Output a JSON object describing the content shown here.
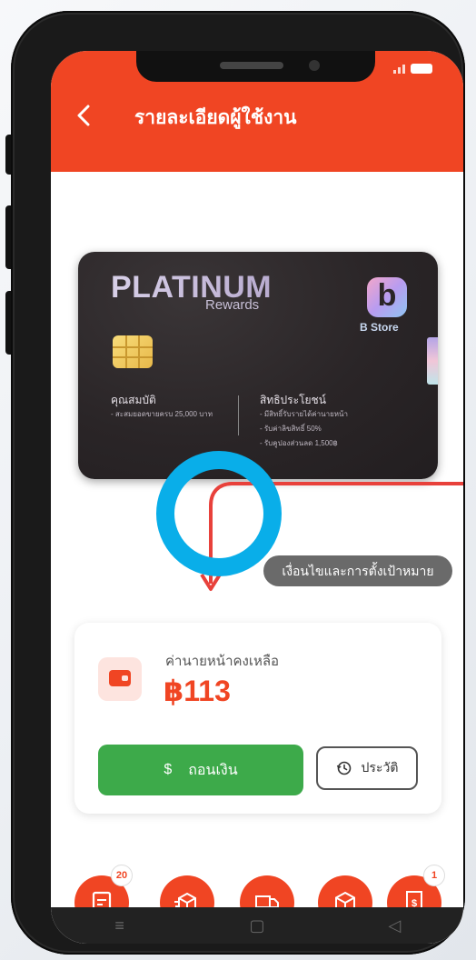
{
  "header": {
    "title": "รายละเอียดผู้ใช้งาน",
    "back_icon": "chevron-left-icon"
  },
  "status_bar": {
    "icons": [
      "signal-icon",
      "battery-icon"
    ]
  },
  "membership_card": {
    "tier": "PLATINUM",
    "tier_subtitle": "Rewards",
    "brand": "B Store",
    "qualification": {
      "heading": "คุณสมบัติ",
      "lines": [
        "- สะสมยอดขายครบ 25,000 บาท"
      ]
    },
    "benefits": {
      "heading": "สิทธิประโยชน์",
      "lines": [
        "- มีสิทธิ์รับรายได้ค่านายหน้า",
        "- รับค่าลิขสิทธิ์ 50%",
        "- รับคูปองส่วนลด 1,500฿"
      ]
    }
  },
  "goal_button": {
    "label": "เงื่อนไขและการตั้งเป้าหมาย"
  },
  "balance": {
    "label": "ค่านายหน้าคงเหลือ",
    "amount": "฿113",
    "icon": "wallet-icon"
  },
  "withdraw_button": {
    "icon": "$",
    "label": "ถอนเงิน"
  },
  "history_button": {
    "icon": "history-icon",
    "label": "ประวัติ"
  },
  "quick_actions": [
    {
      "icon": "order-list-icon",
      "badge": "20"
    },
    {
      "icon": "box-export-icon",
      "badge": ""
    },
    {
      "icon": "delivery-truck-icon",
      "badge": ""
    },
    {
      "icon": "package-icon",
      "badge": ""
    },
    {
      "icon": "receipt-icon",
      "badge": "1"
    }
  ],
  "nav_bar": {
    "items": [
      "≡",
      "▢",
      "◁"
    ]
  },
  "colors": {
    "primary": "#f04523",
    "success": "#3daa4a",
    "annotation_ring": "#09aee9",
    "annotation_arrow": "#e8413b",
    "card_dark": "#2a2527"
  }
}
